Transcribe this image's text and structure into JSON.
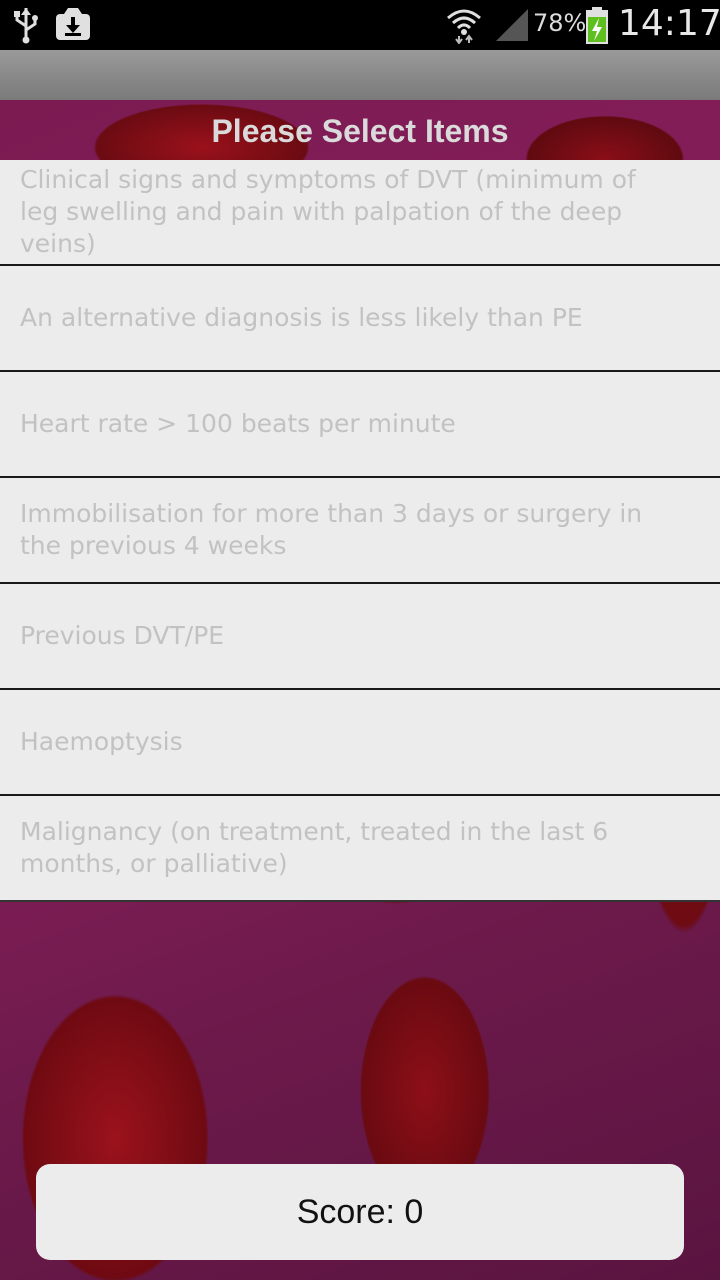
{
  "status_bar": {
    "icons": [
      "usb-icon",
      "download-icon",
      "wifi-icon",
      "signal-icon",
      "battery-charging-icon"
    ],
    "battery_percent": "78%",
    "time": "14:17"
  },
  "heading": "Please Select Items",
  "items": [
    {
      "label": "Clinical signs and symptoms of DVT (minimum of leg swelling and pain with palpation of the deep veins)"
    },
    {
      "label": "An alternative diagnosis is less likely than PE"
    },
    {
      "label": "Heart rate > 100 beats per minute"
    },
    {
      "label": "Immobilisation for more than 3 days or surgery in the previous 4 weeks"
    },
    {
      "label": "Previous DVT/PE"
    },
    {
      "label": "Haemoptysis"
    },
    {
      "label": "Malignancy (on treatment, treated in the last 6 months, or palliative)"
    }
  ],
  "score_button": {
    "label": "Score: 0"
  },
  "colors": {
    "status_bar": "#000000",
    "list_bg": "#ececec",
    "divider": "#1a1a1a",
    "item_text": "#c2c2c2"
  }
}
